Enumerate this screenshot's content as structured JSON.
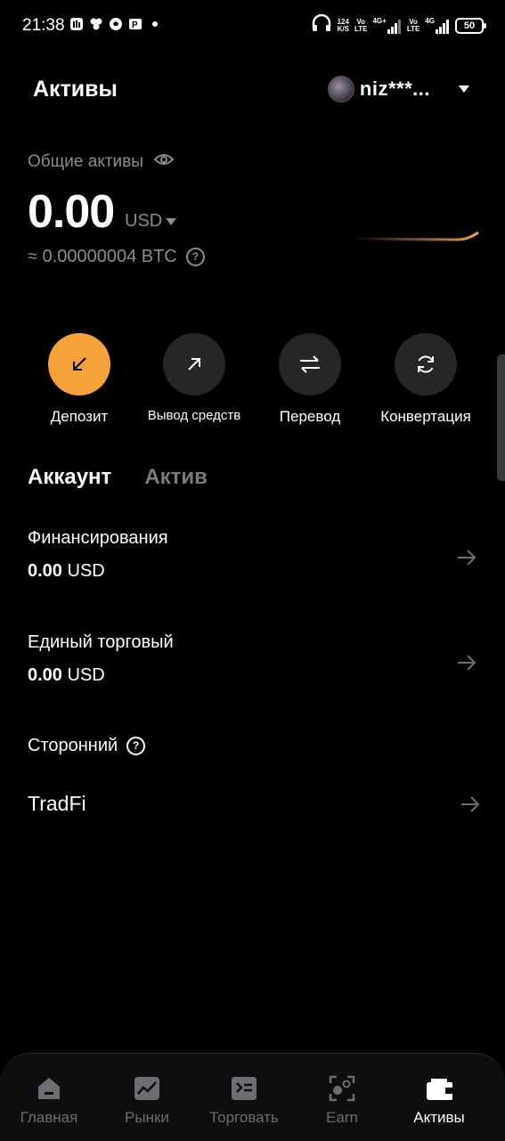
{
  "status_bar": {
    "time": "21:38",
    "net_speed_top": "124",
    "net_speed_bottom": "K/S",
    "sim1_top": "Vo",
    "sim1_bottom": "LTE",
    "sim1_net": "4G+",
    "sim2_top": "Vo",
    "sim2_bottom": "LTE",
    "sim2_net": "4G",
    "battery": "50"
  },
  "header": {
    "title": "Активы",
    "account_name": "niz***..."
  },
  "balance": {
    "label": "Общие активы",
    "amount": "0.00",
    "currency": "USD",
    "btc_equivalent": "≈ 0.00000004 BTC",
    "help": "?"
  },
  "actions": [
    {
      "label": "Депозит",
      "icon": "deposit-arrow-icon"
    },
    {
      "label": "Вывод средств",
      "icon": "withdraw-arrow-icon"
    },
    {
      "label": "Перевод",
      "icon": "transfer-icon"
    },
    {
      "label": "Конвертация",
      "icon": "convert-icon"
    }
  ],
  "tabs": [
    {
      "label": "Аккаунт",
      "active": true
    },
    {
      "label": "Актив",
      "active": false
    }
  ],
  "accounts": {
    "funding": {
      "label": "Финансирования",
      "amount": "0.00",
      "currency": "USD"
    },
    "unified": {
      "label": "Единый торговый",
      "amount": "0.00",
      "currency": "USD"
    },
    "third_party_label": "Сторонний",
    "third_party_help": "?",
    "tradfi": "TradFi"
  },
  "bottom_nav": [
    {
      "label": "Главная",
      "icon": "home-icon"
    },
    {
      "label": "Рынки",
      "icon": "chart-icon"
    },
    {
      "label": "Торговать",
      "icon": "trade-icon"
    },
    {
      "label": "Earn",
      "icon": "earn-icon"
    },
    {
      "label": "Активы",
      "icon": "wallet-icon",
      "active": true
    }
  ],
  "colors": {
    "accent": "#f7a13a",
    "background": "#000000",
    "muted_text": "#8c8c8c",
    "button_bg": "#262629"
  }
}
